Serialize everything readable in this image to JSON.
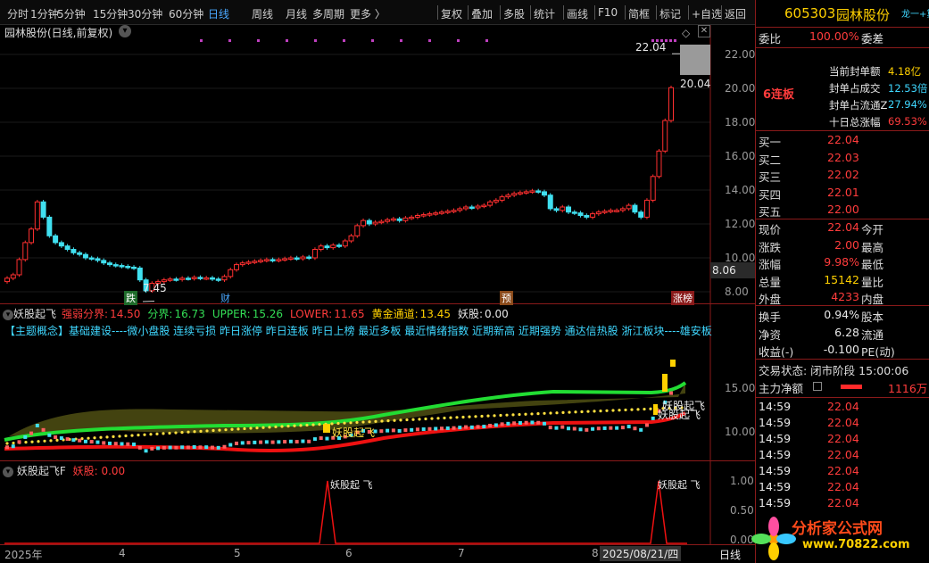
{
  "toolbar": {
    "left": [
      "分时",
      "1分钟",
      "5分钟",
      "15分钟",
      "30分钟",
      "60分钟",
      "日线",
      "周线",
      "月线",
      "多周期",
      "更多 〉"
    ],
    "right": [
      "复权",
      "叠加",
      "多股",
      "统计",
      "画线",
      "F10",
      "简框",
      "标记",
      "+自选",
      "返回"
    ],
    "active": "日线"
  },
  "main": {
    "title": "园林股份(日线,前复权)",
    "y_ticks": [
      "22.00",
      "20.00",
      "18.00",
      "16.00",
      "14.00",
      "12.00",
      "10.00",
      "8.00"
    ],
    "high_label": "22.04",
    "low_label": "7.45",
    "price_tag": "20.04",
    "current_box": "8.06",
    "event_marks": [
      "跌",
      "财",
      "预",
      "涨榜"
    ]
  },
  "sub1": {
    "title": "妖股起飞",
    "metrics": [
      {
        "label": "强弱分界:",
        "value": "14.50",
        "color": "#ff3c3c"
      },
      {
        "label": "分界:",
        "value": "16.73",
        "color": "#33dd55"
      },
      {
        "label": "UPPER:",
        "value": "15.26",
        "color": "#33dd55"
      },
      {
        "label": "LOWER:",
        "value": "11.65",
        "color": "#ff3c3c"
      },
      {
        "label": "黄金通道:",
        "value": "13.45",
        "color": "#ffd000"
      },
      {
        "label": "妖股:",
        "value": "0.00",
        "color": "#e8e8e8"
      }
    ],
    "concepts": "【主题概念】基础建设----微小盘股 连续亏损 昨日涨停 昨日连板 昨日上榜 最近多板 最近情绪指数 近期新高 近期强势 通达信热股 浙江板块----雄安板",
    "y_ticks": [
      "15.00",
      "10.00"
    ],
    "signal_text": "妖股起飞"
  },
  "sub2": {
    "title": "妖股起飞F",
    "metric_label": "妖股:",
    "metric_value": "0.00",
    "y_ticks": [
      "1.00",
      "0.50",
      "0.00"
    ],
    "signal_text": "妖股起 飞"
  },
  "datebar": {
    "labels": [
      "2025年",
      "4",
      "5",
      "6",
      "7",
      "8",
      "2025/08/21/四"
    ],
    "period": "日线"
  },
  "stock": {
    "code": "605303",
    "name": "园林股份",
    "corner": "龙一+算",
    "webi_label": "委比",
    "webi_value": "100.00%",
    "weicha_label": "委差",
    "lianban": "6连板",
    "seal_stats": [
      {
        "label": "当前封单额",
        "value": "4.18亿",
        "color": "#ffd000"
      },
      {
        "label": "封单占成交",
        "value": "12.53倍",
        "color": "#3fd7ff"
      },
      {
        "label": "封单占流通Z",
        "value": "27.94%",
        "color": "#3fd7ff"
      },
      {
        "label": "十日总涨幅",
        "value": "69.53%",
        "color": "#ff3c3c"
      }
    ],
    "bids": [
      {
        "label": "买一",
        "price": "22.04"
      },
      {
        "label": "买二",
        "price": "22.03"
      },
      {
        "label": "买三",
        "price": "22.02"
      },
      {
        "label": "买四",
        "price": "22.01"
      },
      {
        "label": "买五",
        "price": "22.00"
      }
    ],
    "quote": [
      {
        "l1": "现价",
        "v1": "22.04",
        "c1": "#ff3c3c",
        "l2": "今开"
      },
      {
        "l1": "涨跌",
        "v1": "2.00",
        "c1": "#ff3c3c",
        "l2": "最高"
      },
      {
        "l1": "涨幅",
        "v1": "9.98%",
        "c1": "#ff3c3c",
        "l2": "最低"
      },
      {
        "l1": "总量",
        "v1": "15142",
        "c1": "#ffd000",
        "l2": "量比"
      },
      {
        "l1": "外盘",
        "v1": "4233",
        "c1": "#ff3c3c",
        "l2": "内盘"
      }
    ],
    "stats": [
      {
        "l1": "换手",
        "v1": "0.94%",
        "l2": "股本"
      },
      {
        "l1": "净资",
        "v1": "6.28",
        "l2": "流通"
      },
      {
        "l1": "收益(-)",
        "v1": "-0.100",
        "l2": "PE(动)"
      }
    ],
    "trade_status": "交易状态: 闭市阶段 15:00:06",
    "inflow_label": "主力净额",
    "inflow_value": "1116万",
    "ticks": [
      {
        "time": "14:59",
        "price": "22.04"
      },
      {
        "time": "14:59",
        "price": "22.04"
      },
      {
        "time": "14:59",
        "price": "22.04"
      },
      {
        "time": "14:59",
        "price": "22.04"
      },
      {
        "time": "14:59",
        "price": "22.04"
      },
      {
        "time": "14:59",
        "price": "22.04"
      },
      {
        "time": "14:59",
        "price": "22.04"
      }
    ],
    "watermark_cn": "分析家公式网",
    "watermark_url": "www.70822.com"
  },
  "chart_data": {
    "type": "candlestick",
    "y_range": [
      7.0,
      23.0
    ],
    "closes": [
      8.8,
      9.0,
      9.9,
      10.9,
      11.7,
      13.3,
      12.4,
      11.3,
      10.9,
      10.7,
      10.5,
      10.3,
      10.2,
      10.0,
      9.95,
      9.85,
      9.7,
      9.6,
      9.55,
      9.5,
      9.45,
      9.4,
      8.7,
      8.06,
      8.5,
      8.6,
      8.7,
      8.75,
      8.72,
      8.8,
      8.78,
      8.85,
      8.8,
      8.82,
      8.75,
      8.7,
      8.9,
      9.3,
      9.6,
      9.7,
      9.75,
      9.8,
      9.85,
      9.9,
      9.85,
      9.9,
      9.95,
      10.0,
      9.95,
      10.05,
      10.0,
      10.5,
      10.7,
      10.6,
      10.75,
      10.7,
      11.0,
      11.3,
      11.9,
      12.2,
      12.0,
      12.1,
      12.15,
      12.25,
      12.3,
      12.2,
      12.35,
      12.4,
      12.5,
      12.55,
      12.6,
      12.65,
      12.7,
      12.75,
      12.8,
      12.9,
      13.0,
      12.95,
      13.05,
      13.1,
      13.3,
      13.4,
      13.6,
      13.7,
      13.8,
      13.85,
      13.9,
      13.95,
      13.9,
      13.7,
      12.9,
      12.8,
      13.0,
      12.7,
      12.65,
      12.5,
      12.4,
      12.6,
      12.7,
      12.75,
      12.8,
      12.8,
      12.9,
      13.1,
      12.7,
      12.4,
      13.4,
      14.8,
      16.3,
      18.1,
      20.04
    ]
  }
}
